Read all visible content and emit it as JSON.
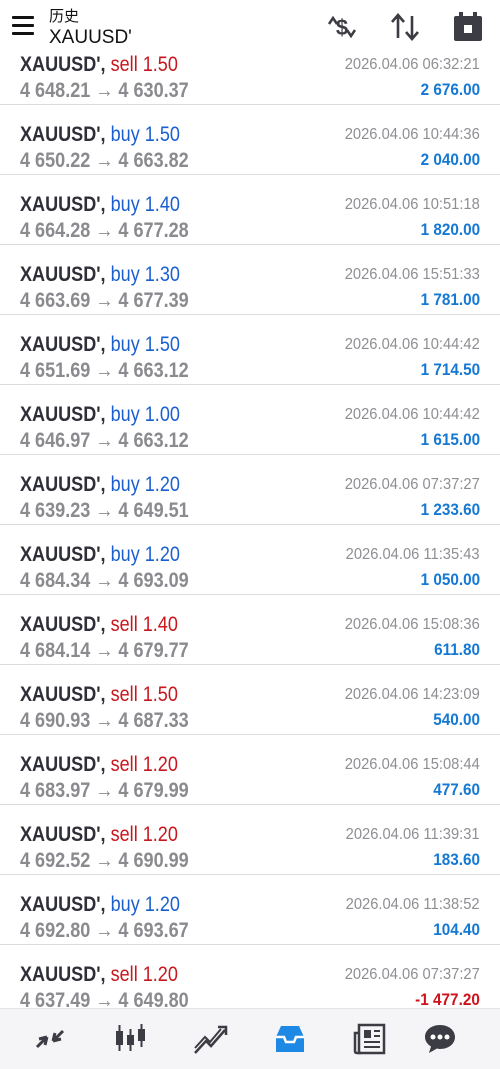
{
  "header": {
    "title": "历史",
    "subtitle": "XAUUSD'",
    "icons": [
      "menu-icon",
      "currency-exchange-icon",
      "sort-icon",
      "calendar-icon"
    ]
  },
  "trades": [
    {
      "symbol": "XAUUSD',",
      "side": "sell",
      "volume": "1.50",
      "open": "4 648.21",
      "close": "4 630.37",
      "arrow": "→",
      "time": "2026.04.06 06:32:21",
      "profit": "2 676.00"
    },
    {
      "symbol": "XAUUSD',",
      "side": "buy",
      "volume": "1.50",
      "open": "4 650.22",
      "close": "4 663.82",
      "arrow": "→",
      "time": "2026.04.06 10:44:36",
      "profit": "2 040.00"
    },
    {
      "symbol": "XAUUSD',",
      "side": "buy",
      "volume": "1.40",
      "open": "4 664.28",
      "close": "4 677.28",
      "arrow": "→",
      "time": "2026.04.06 10:51:18",
      "profit": "1 820.00"
    },
    {
      "symbol": "XAUUSD',",
      "side": "buy",
      "volume": "1.30",
      "open": "4 663.69",
      "close": "4 677.39",
      "arrow": "→",
      "time": "2026.04.06 15:51:33",
      "profit": "1 781.00"
    },
    {
      "symbol": "XAUUSD',",
      "side": "buy",
      "volume": "1.50",
      "open": "4 651.69",
      "close": "4 663.12",
      "arrow": "→",
      "time": "2026.04.06 10:44:42",
      "profit": "1 714.50"
    },
    {
      "symbol": "XAUUSD',",
      "side": "buy",
      "volume": "1.00",
      "open": "4 646.97",
      "close": "4 663.12",
      "arrow": "→",
      "time": "2026.04.06 10:44:42",
      "profit": "1 615.00"
    },
    {
      "symbol": "XAUUSD',",
      "side": "buy",
      "volume": "1.20",
      "open": "4 639.23",
      "close": "4 649.51",
      "arrow": "→",
      "time": "2026.04.06 07:37:27",
      "profit": "1 233.60"
    },
    {
      "symbol": "XAUUSD',",
      "side": "buy",
      "volume": "1.20",
      "open": "4 684.34",
      "close": "4 693.09",
      "arrow": "→",
      "time": "2026.04.06 11:35:43",
      "profit": "1 050.00"
    },
    {
      "symbol": "XAUUSD',",
      "side": "sell",
      "volume": "1.40",
      "open": "4 684.14",
      "close": "4 679.77",
      "arrow": "→",
      "time": "2026.04.06 15:08:36",
      "profit": "611.80"
    },
    {
      "symbol": "XAUUSD',",
      "side": "sell",
      "volume": "1.50",
      "open": "4 690.93",
      "close": "4 687.33",
      "arrow": "→",
      "time": "2026.04.06 14:23:09",
      "profit": "540.00"
    },
    {
      "symbol": "XAUUSD',",
      "side": "sell",
      "volume": "1.20",
      "open": "4 683.97",
      "close": "4 679.99",
      "arrow": "→",
      "time": "2026.04.06 15:08:44",
      "profit": "477.60"
    },
    {
      "symbol": "XAUUSD',",
      "side": "sell",
      "volume": "1.20",
      "open": "4 692.52",
      "close": "4 690.99",
      "arrow": "→",
      "time": "2026.04.06 11:39:31",
      "profit": "183.60"
    },
    {
      "symbol": "XAUUSD',",
      "side": "buy",
      "volume": "1.20",
      "open": "4 692.80",
      "close": "4 693.67",
      "arrow": "→",
      "time": "2026.04.06 11:38:52",
      "profit": "104.40"
    },
    {
      "symbol": "XAUUSD',",
      "side": "sell",
      "volume": "1.20",
      "open": "4 637.49",
      "close": "4 649.80",
      "arrow": "→",
      "time": "2026.04.06 07:37:27",
      "profit": "-1 477.20"
    }
  ],
  "colors": {
    "buy": "#1a5fd0",
    "sell": "#c8161d",
    "profit_positive": "#1579d3",
    "profit_negative": "#d0121b",
    "nav_active": "#1e88e5",
    "nav_inactive": "#3c3c44"
  },
  "bottom_nav": [
    {
      "icon": "quotes-icon",
      "active": false
    },
    {
      "icon": "chart-icon",
      "active": false
    },
    {
      "icon": "trade-icon",
      "active": false
    },
    {
      "icon": "history-icon",
      "active": true
    },
    {
      "icon": "news-icon",
      "active": false
    },
    {
      "icon": "chat-icon",
      "active": false
    }
  ]
}
